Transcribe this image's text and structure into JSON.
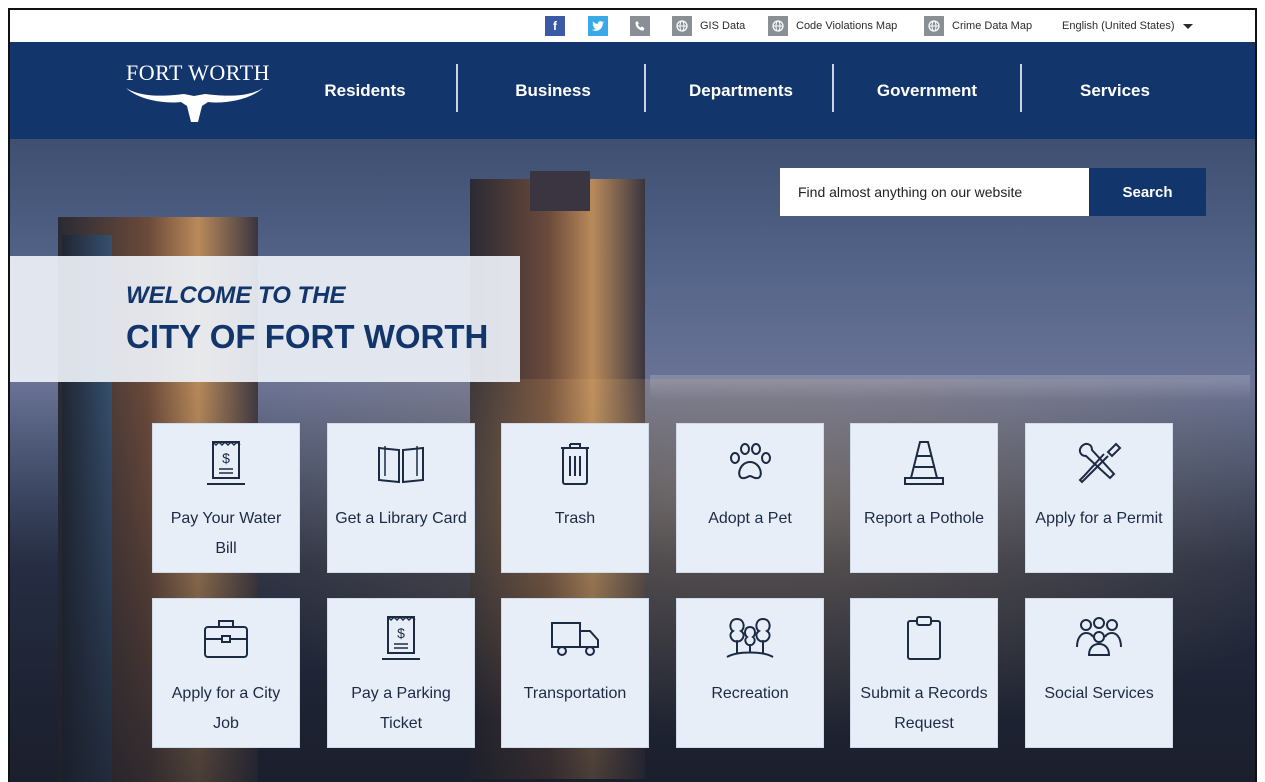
{
  "utility_bar": {
    "social": [
      "facebook-icon",
      "twitter-icon",
      "phone-icon"
    ],
    "links": [
      {
        "label": "GIS Data",
        "icon": "globe-icon"
      },
      {
        "label": "Code Violations Map",
        "icon": "globe-icon"
      },
      {
        "label": "Crime Data Map",
        "icon": "globe-icon"
      }
    ],
    "language": "English (United States)"
  },
  "brand": {
    "logo_text": "FORT WORTH",
    "logo_icon": "longhorn-icon"
  },
  "nav": {
    "items": [
      "Residents",
      "Business",
      "Departments",
      "Government",
      "Services"
    ]
  },
  "search": {
    "placeholder": "Find almost anything on our website",
    "button_label": "Search"
  },
  "welcome": {
    "line1": "WELCOME TO THE",
    "line2": "CITY OF FORT WORTH"
  },
  "tiles": [
    {
      "label": "Pay Your Water Bill",
      "icon": "receipt-dollar-icon"
    },
    {
      "label": "Get a Library Card",
      "icon": "open-book-icon"
    },
    {
      "label": "Trash",
      "icon": "trash-can-icon"
    },
    {
      "label": "Adopt a Pet",
      "icon": "paw-print-icon"
    },
    {
      "label": "Report a Pothole",
      "icon": "traffic-cone-icon"
    },
    {
      "label": "Apply for a Permit",
      "icon": "wrench-screwdriver-icon"
    },
    {
      "label": "Apply for a City Job",
      "icon": "briefcase-icon"
    },
    {
      "label": "Pay a Parking Ticket",
      "icon": "receipt-dollar-icon"
    },
    {
      "label": "Transportation",
      "icon": "truck-icon"
    },
    {
      "label": "Recreation",
      "icon": "trees-icon"
    },
    {
      "label": "Submit a Records Request",
      "icon": "clipboard-icon"
    },
    {
      "label": "Social Services",
      "icon": "people-group-icon"
    }
  ],
  "colors": {
    "navy": "#12366b",
    "tile_bg": "#e7eef8",
    "facebook": "#3b5aa6",
    "twitter": "#39a9e8"
  }
}
